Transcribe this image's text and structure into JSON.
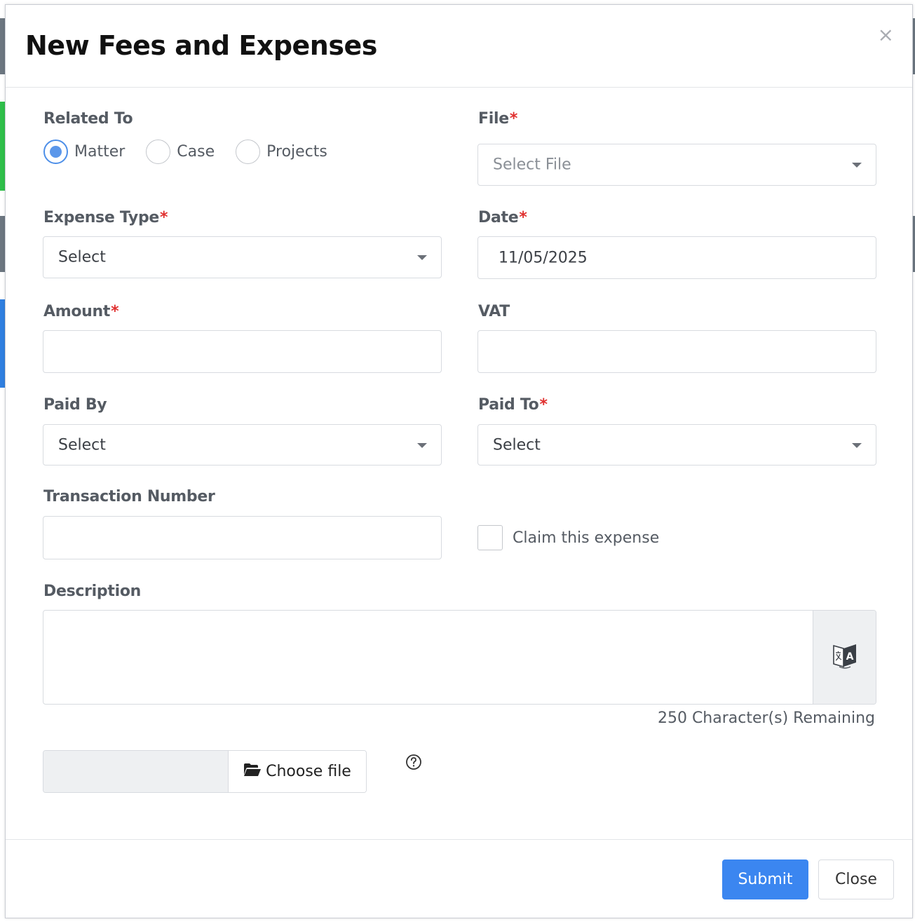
{
  "colors": {
    "accent": "#3b86f0",
    "required": "#e0302f",
    "radio_checked": "#5b97ea",
    "bg_strip_green": "#2fbf4a",
    "bg_strip_blue": "#2f7fe0",
    "bg_strip_gray": "#6c7680"
  },
  "modal": {
    "title": "New Fees and Expenses",
    "close_glyph": "×"
  },
  "form": {
    "related_to": {
      "label": "Related To",
      "options": [
        {
          "label": "Matter",
          "checked": true
        },
        {
          "label": "Case",
          "checked": false
        },
        {
          "label": "Projects",
          "checked": false
        }
      ]
    },
    "file": {
      "label": "File",
      "required_mark": "*",
      "placeholder": "Select File"
    },
    "expense_type": {
      "label": "Expense Type",
      "required_mark": "*",
      "value": "Select"
    },
    "date": {
      "label": "Date",
      "required_mark": "*",
      "value": "11/05/2025"
    },
    "amount": {
      "label": "Amount",
      "required_mark": "*",
      "value": ""
    },
    "vat": {
      "label": "VAT",
      "value": ""
    },
    "paid_by": {
      "label": "Paid By",
      "value": "Select"
    },
    "paid_to": {
      "label": "Paid To",
      "required_mark": "*",
      "value": "Select"
    },
    "transaction_number": {
      "label": "Transaction Number",
      "value": ""
    },
    "claim": {
      "label": "Claim this expense",
      "checked": false
    },
    "description": {
      "label": "Description",
      "value": "",
      "translate_icon": "translate-icon",
      "remaining": "250 Character(s) Remaining"
    },
    "attachment": {
      "button_label": "Choose file",
      "button_icon": "folder-open-icon",
      "help_icon": "question-circle-icon"
    }
  },
  "footer": {
    "submit_label": "Submit",
    "close_label": "Close"
  }
}
